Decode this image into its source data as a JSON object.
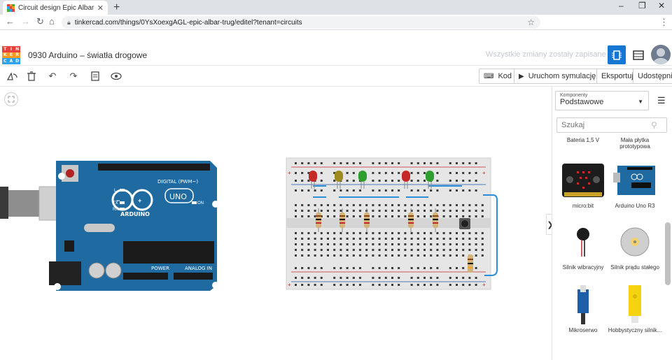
{
  "browser": {
    "tab_title": "Circuit design Epic Albar-Trug | T...",
    "tab_close": "✕",
    "new_tab": "+",
    "url": "tinkercad.com/things/0YsXoexgAGL-epic-albar-trug/editel?tenant=circuits",
    "window_controls": [
      "–",
      "❐",
      "✕"
    ]
  },
  "app": {
    "logo_letters": [
      "TIN",
      "KER",
      "CAD"
    ],
    "logo_colors": [
      "#e8403b",
      "#f59a23",
      "#44b035",
      "#2ea3f2"
    ],
    "project_title": "0930 Arduino – światła drogowe",
    "save_status": "Wszystkie zmiany zostały zapisane"
  },
  "toolbar": {
    "code_label": "Kod",
    "simulate_label": "Uruchom symulację",
    "export_label": "Eksportuj",
    "share_label": "Udostępnij"
  },
  "panel": {
    "components_label": "Komponenty",
    "components_value": "Podstawowe",
    "search_placeholder": "Szukaj",
    "collapse_glyph": "❯",
    "items": [
      {
        "label": "Bateria 1,5 V"
      },
      {
        "label": "Mała płytka prototypowa"
      },
      {
        "label": "micro:bit"
      },
      {
        "label": "Arduino Uno R3"
      },
      {
        "label": "Silnik wibracyjny"
      },
      {
        "label": "Silnik prądu stałego"
      },
      {
        "label": "Mikroserwo"
      },
      {
        "label": "Hobbystyczny silnik..."
      }
    ]
  },
  "board": {
    "digital_label": "DIGITAL (PWM~)",
    "brand": "ARDUINO",
    "model": "UNO",
    "on_label": "ON",
    "power_label": "POWER",
    "analog_label": "ANALOG IN",
    "l_label": "L",
    "tx_label": "TX",
    "rx_label": "RX"
  },
  "breadboard": {
    "leds": [
      "#c62828",
      "#9e8a1e",
      "#2e9e2e",
      "#c62828",
      "#2e9e2e"
    ],
    "plus": "+",
    "minus": "−"
  }
}
